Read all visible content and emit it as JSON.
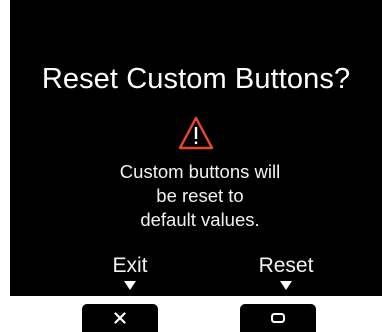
{
  "dialog": {
    "title": "Reset Custom Buttons?",
    "icon": "warning-triangle-icon",
    "message_lines": [
      "Custom buttons will",
      "be reset to",
      "default values."
    ],
    "accent_color": "#e8452b"
  },
  "softkeys": {
    "exit_label": "Exit",
    "reset_label": "Reset"
  },
  "hardware_buttons": {
    "exit_icon": "close-icon",
    "reset_icon": "square-icon"
  }
}
